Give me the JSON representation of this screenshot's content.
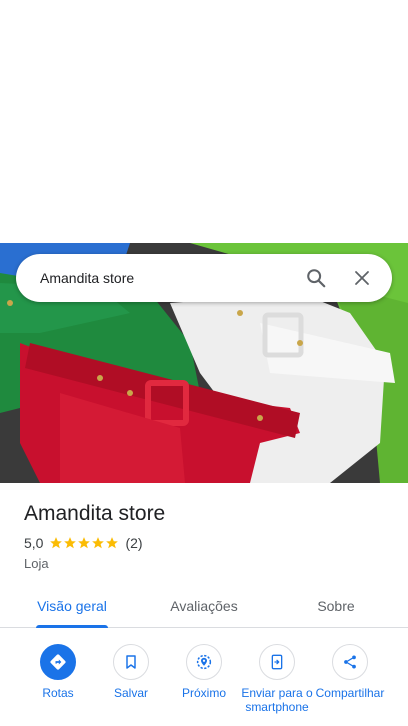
{
  "search": {
    "query": "Amandita store",
    "search_icon": "search-icon",
    "close_icon": "close-icon"
  },
  "hero": {
    "image": "photo of red, green and white belted shorts"
  },
  "place": {
    "title": "Amandita store",
    "rating": "5,0",
    "stars": 5,
    "review_count": "(2)",
    "category": "Loja"
  },
  "colors": {
    "accent": "#1a73e8",
    "star": "#fbbc04",
    "text": "#202124",
    "muted": "#5f6368"
  },
  "tabs": [
    {
      "label": "Visão geral",
      "active": true
    },
    {
      "label": "Avaliações",
      "active": false
    },
    {
      "label": "Sobre",
      "active": false
    }
  ],
  "actions": [
    {
      "label": "Rotas",
      "icon": "directions-icon"
    },
    {
      "label": "Salvar",
      "icon": "bookmark-icon"
    },
    {
      "label": "Próximo",
      "icon": "nearby-icon"
    },
    {
      "label": "Enviar para o smartphone",
      "icon": "send-to-phone-icon"
    },
    {
      "label": "Compartilhar",
      "icon": "share-icon"
    }
  ]
}
